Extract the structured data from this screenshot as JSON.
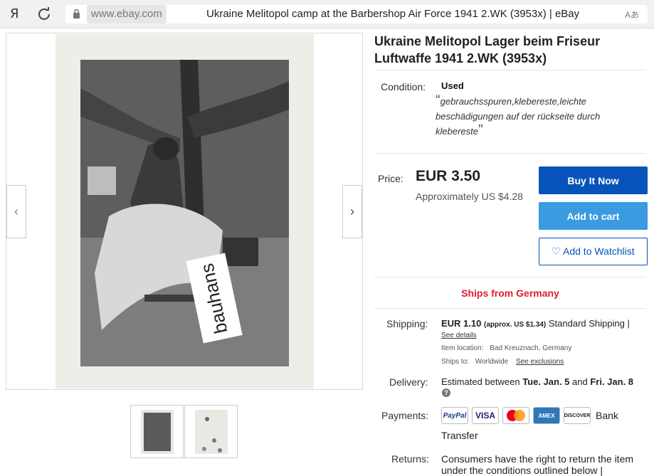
{
  "browser": {
    "logo": "Я",
    "domain": "www.ebay.com",
    "tab_title": "Ukraine Melitopol camp at the Barbershop Air Force 1941 2.WK (3953x) | eBay",
    "translate": "Aあ"
  },
  "gallery": {
    "watermark": "bauhans",
    "prev_arrow": "‹",
    "next_arrow": "›",
    "thumbnail_count": 2
  },
  "listing": {
    "title": "Ukraine Melitopol Lager beim Friseur Luftwaffe 1941 2.WK (3953x)",
    "condition_label": "Condition:",
    "condition_value": "Used",
    "condition_desc": "gebrauchsspuren,klebereste,leichte beschädigungen auf der rückseite durch klebereste",
    "open_quote": "“",
    "close_quote": "”",
    "price_label": "Price:",
    "price": "EUR 3.50",
    "approx": "Approximately US $4.28",
    "buy_now": "Buy It Now",
    "add_cart": "Add to cart",
    "watchlist": "♡ Add to Watchlist",
    "ships_from": "Ships from Germany"
  },
  "shipping": {
    "label": "Shipping:",
    "cost": "EUR 1.10",
    "approx": "(approx. US $1.34)",
    "service": "Standard Shipping |",
    "see_details": "See details",
    "item_location_label": "Item location:",
    "item_location": "Bad Kreuznach, Germany",
    "ships_to_label": "Ships to:",
    "ships_to": "Worldwide",
    "see_exclusions": "See exclusions"
  },
  "delivery": {
    "label": "Delivery:",
    "prefix": "Estimated between ",
    "start": "Tue. Jan. 5",
    "and": " and ",
    "end": "Fri. Jan. 8",
    "help": "?"
  },
  "payments": {
    "label": "Payments:",
    "paypal": "PayPal",
    "visa": "VISA",
    "amex": "AMEX",
    "discover": "DISCOVER",
    "bank": "Bank",
    "transfer": "Transfer"
  },
  "returns": {
    "label": "Returns:",
    "text": "Consumers have the right to return the item under the conditions outlined below |"
  }
}
